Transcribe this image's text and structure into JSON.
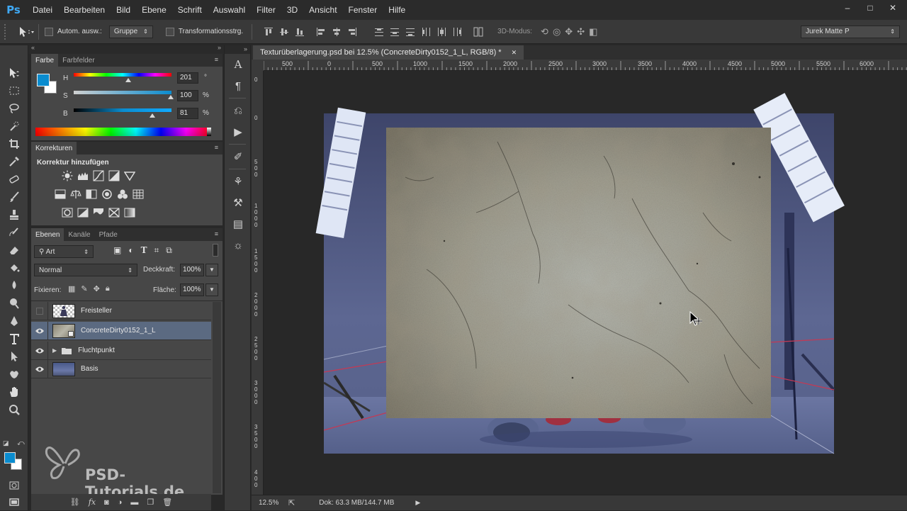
{
  "app": {
    "logo": "Ps"
  },
  "menu": [
    "Datei",
    "Bearbeiten",
    "Bild",
    "Ebene",
    "Schrift",
    "Auswahl",
    "Filter",
    "3D",
    "Ansicht",
    "Fenster",
    "Hilfe"
  ],
  "window_controls": {
    "minimize": "–",
    "maximize": "□",
    "close": "✕"
  },
  "options": {
    "auto_select_label": "Autom. ausw.:",
    "auto_select_value": "Gruppe",
    "transform_label": "Transformationsstrg.",
    "mode_3d_label": "3D-Modus:",
    "workspace": "Jurek Matte P"
  },
  "color_panel": {
    "tabs": [
      "Farbe",
      "Farbfelder"
    ],
    "h_label": "H",
    "h_value": "201",
    "h_unit": "°",
    "s_label": "S",
    "s_value": "100",
    "s_unit": "%",
    "b_label": "B",
    "b_value": "81",
    "b_unit": "%",
    "foreground_color": "#0a8ccf",
    "background_color": "#ffffff"
  },
  "corrections_panel": {
    "tab": "Korrekturen",
    "heading": "Korrektur hinzufügen"
  },
  "layers_panel": {
    "tabs": [
      "Ebenen",
      "Kanäle",
      "Pfade"
    ],
    "filter_kind": "Art",
    "blend_mode": "Normal",
    "opacity_label": "Deckkraft:",
    "opacity_value": "100%",
    "lock_label": "Fixieren:",
    "fill_label": "Fläche:",
    "fill_value": "100%",
    "layers": [
      {
        "name": "Freisteller",
        "visible": false,
        "selected": false
      },
      {
        "name": "ConcreteDirty0152_1_L",
        "visible": true,
        "selected": true
      },
      {
        "name": "Fluchtpunkt",
        "visible": true,
        "selected": false,
        "group": true
      },
      {
        "name": "Basis",
        "visible": true,
        "selected": false
      }
    ]
  },
  "document": {
    "tab_title": "Texturüberlagerung.psd bei 12.5% (ConcreteDirty0152_1_L, RGB/8) *",
    "close": "✕",
    "ruler_h": [
      "500",
      "0",
      "500",
      "1000",
      "1500",
      "2000",
      "2500",
      "3000",
      "3500",
      "4000",
      "4500",
      "5000",
      "5500",
      "6000"
    ],
    "ruler_v": [
      "0",
      "0",
      "5 0 0",
      "1 0 0 0",
      "1 5 0 0",
      "2 0 0 0",
      "2 5 0 0",
      "3 0 0 0",
      "3 5 0 0",
      "4 0 0"
    ]
  },
  "status": {
    "zoom": "12.5%",
    "doc_size": "Dok: 63.3 MB/144.7 MB"
  },
  "watermark": "PSD-Tutorials.de"
}
